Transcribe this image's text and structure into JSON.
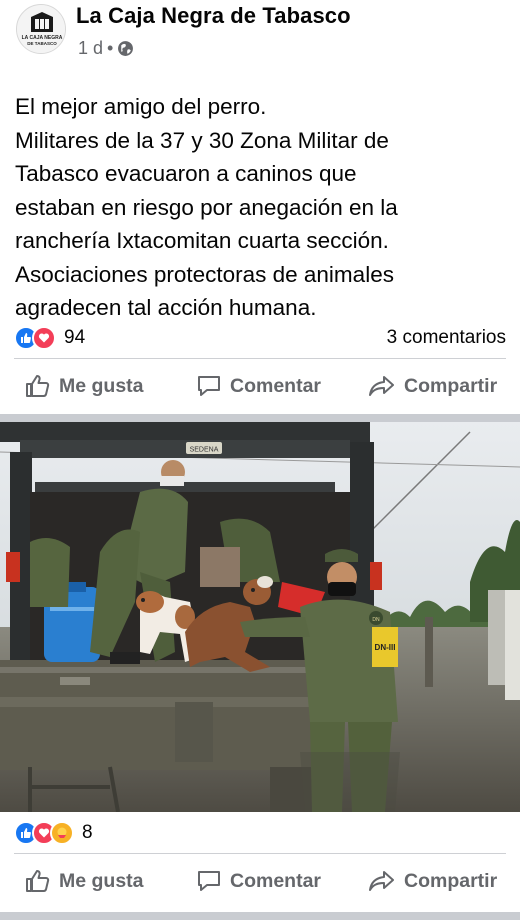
{
  "post": {
    "page_name": "La Caja Negra de Tabasco",
    "avatar_text_line1": "LA CAJA NEGRA",
    "avatar_text_line2": "DE TABASCO",
    "time": "1 d",
    "privacy_icon": "globe-icon",
    "text_lines": [
      "El mejor amigo del perro.",
      "Militares de la 37 y 30 Zona Militar de",
      "Tabasco evacuaron a caninos que",
      "estaban en riesgo por anegación en la",
      "ranchería Ixtacomitan cuarta sección.",
      "Asociaciones protectoras de animales",
      "agradecen tal acción humana."
    ],
    "reaction_count": "94",
    "comments_label": "3 comentarios",
    "reactions": [
      "like-icon",
      "love-icon"
    ]
  },
  "actions": {
    "like": "Me gusta",
    "comment": "Comentar",
    "share": "Compartir"
  },
  "photo": {
    "truck_plate": "SEDENA",
    "emblem_text": "DN",
    "arm_badge_text": "DN-III"
  },
  "photo_post": {
    "reaction_count": "8",
    "reactions": [
      "like-icon",
      "love-icon",
      "care-icon"
    ]
  },
  "colors": {
    "like_blue": "#1877f2",
    "love_red": "#f33e58",
    "care_yellow": "#f7b125",
    "secondary_text": "#65676b",
    "band_gray": "#c9ccd1"
  }
}
